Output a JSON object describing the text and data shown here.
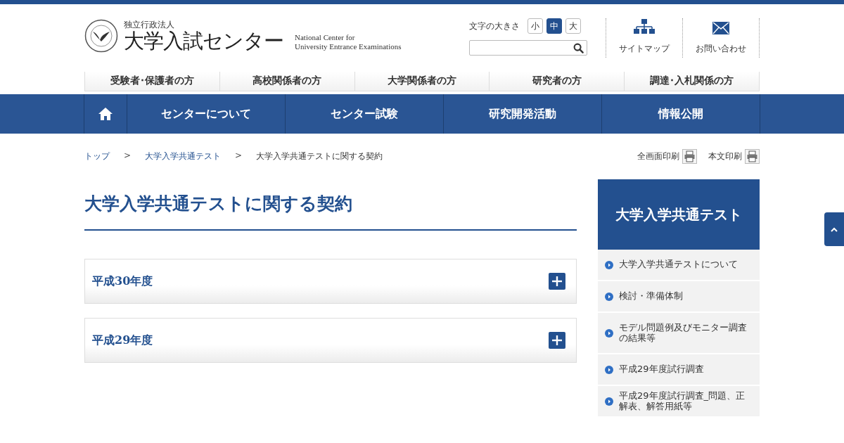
{
  "header": {
    "org_type": "独立行政法人",
    "org_name": "大学入試センター",
    "org_name_en": [
      "National Center for",
      "University Entrance Examinations"
    ],
    "font_size": {
      "label": "文字の大きさ",
      "options": [
        {
          "label": "小",
          "selected": false
        },
        {
          "label": "中",
          "selected": true
        },
        {
          "label": "大",
          "selected": false
        }
      ]
    },
    "links": [
      {
        "kind": "sitemap",
        "label": "サイトマップ"
      },
      {
        "kind": "mail",
        "label": "お問い合わせ"
      }
    ]
  },
  "audience_nav": [
    "受験者･保護者の方",
    "高校関係者の方",
    "大学関係者の方",
    "研究者の方",
    "調達･入札関係の方"
  ],
  "main_nav": [
    "センターについて",
    "センター試験",
    "研究開発活動",
    "情報公開"
  ],
  "breadcrumb": [
    {
      "kind": "link",
      "label": "トップ"
    },
    {
      "kind": "separator",
      "label": ">"
    },
    {
      "kind": "link",
      "label": "大学入学共通テスト"
    },
    {
      "kind": "separator",
      "label": ">"
    },
    {
      "kind": "current",
      "label": "大学入学共通テストに関する契約"
    }
  ],
  "print_links": [
    "全画面印刷",
    "本文印刷"
  ],
  "page_title": "大学入学共通テストに関する契約",
  "accordions": [
    {
      "label": "平成30年度",
      "expanded": false
    },
    {
      "label": "平成29年度",
      "expanded": false
    }
  ],
  "sidebar": {
    "title": "大学入学共通テスト",
    "items": [
      "大学入学共通テストについて",
      "検討・準備体制",
      "モデル問題例及びモニター調査の結果等",
      "平成29年度試行調査",
      "平成29年度試行調査_問題、正解表、解答用紙等"
    ]
  }
}
